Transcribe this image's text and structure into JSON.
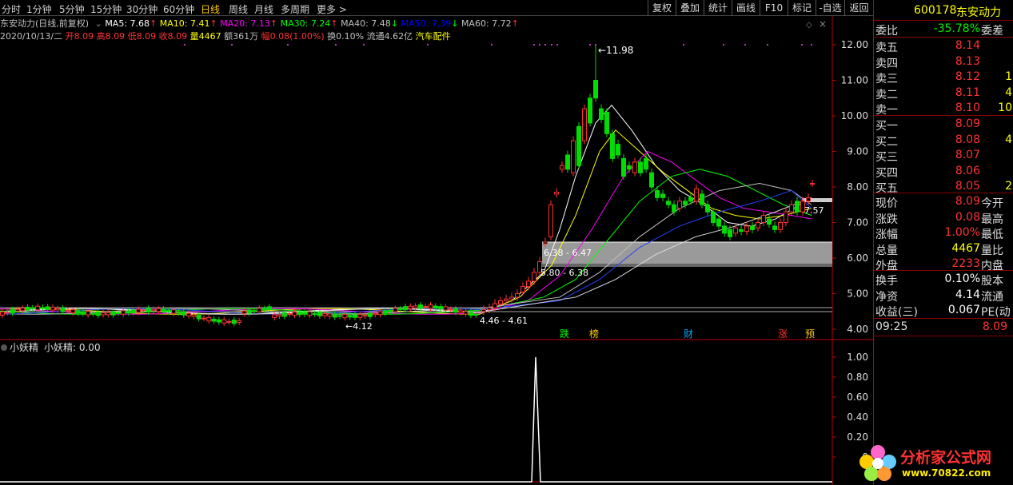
{
  "toolbar": {
    "periods": [
      "分时",
      "1分钟",
      "5分钟",
      "15分钟",
      "30分钟",
      "60分钟",
      "日线",
      "周线",
      "月线",
      "多周期",
      "更多 >"
    ],
    "active_period": "日线",
    "buttons": [
      "复权",
      "叠加",
      "统计",
      "画线",
      "F10",
      "标记",
      "-自选",
      "返回"
    ]
  },
  "ma": [
    {
      "label": "东安动力(日线,前复权)",
      "color": "#c0c0c0"
    },
    {
      "label": "MA5: 7.68",
      "color": "#ffffff",
      "arrow": "↑",
      "arrow_color": "#ff3333"
    },
    {
      "label": "MA10: 7.41",
      "color": "#ffff00",
      "arrow": "↑",
      "arrow_color": "#ff3333"
    },
    {
      "label": "MA20: 7.13",
      "color": "#ff00ff",
      "arrow": "↑",
      "arrow_color": "#ff3333"
    },
    {
      "label": "MA30: 7.24",
      "color": "#00ff00",
      "arrow": "↑",
      "arrow_color": "#ff3333"
    },
    {
      "label": "MA40: 7.48",
      "color": "#c0c0c0",
      "arrow": "↓",
      "arrow_color": "#00ff00"
    },
    {
      "label": "MA50: 7.39",
      "color": "#0000ff",
      "arrow": "↓",
      "arrow_color": "#00ff00"
    },
    {
      "label": "MA60: 7.72",
      "color": "#c0c0c0",
      "arrow": "↑",
      "arrow_color": "#ff3333"
    }
  ],
  "info": {
    "date": "2020/10/13/二",
    "open": "开8.09",
    "high": "高8.09",
    "low": "低8.09",
    "close": "收8.09",
    "vol": "量4467",
    "amount": "额361万",
    "change": "幅0.08(1.00%)",
    "turnover": "换0.10%",
    "float": "流通4.62亿",
    "sector": "汽车配件"
  },
  "main_axis": [
    "12.00",
    "11.00",
    "10.00",
    "9.00",
    "8.00",
    "7.00",
    "6.00",
    "5.00",
    "4.00"
  ],
  "annotations": {
    "high": "11.98",
    "low": "4.12",
    "zone1": "6.38 - 6.47",
    "zone2": "5.80 - 6.38",
    "zone3": "4.46 - 4.61",
    "price": "7.57"
  },
  "markers": [
    {
      "text": "跌",
      "color": "#00ff00"
    },
    {
      "text": "榜",
      "color": "#ffcc00"
    },
    {
      "text": "财",
      "color": "#00aaff"
    },
    {
      "text": "涨",
      "color": "#ff3333"
    },
    {
      "text": "预",
      "color": "#ffcc00"
    }
  ],
  "indicator": {
    "title": "小妖精",
    "label": "小妖精: 0.00",
    "axis": [
      "1.00",
      "0.80",
      "0.60",
      "0.40",
      "0.20",
      "0"
    ]
  },
  "quote": {
    "code": "600178",
    "name": "东安动力",
    "weibi_label": "委比",
    "weibi": "-35.78%",
    "weicha_label": "委差",
    "asks": [
      {
        "label": "卖五",
        "price": "8.14"
      },
      {
        "label": "卖四",
        "price": "8.13"
      },
      {
        "label": "卖三",
        "price": "8.12",
        "vol": "1"
      },
      {
        "label": "卖二",
        "price": "8.11",
        "vol": "4"
      },
      {
        "label": "卖一",
        "price": "8.10",
        "vol": "10"
      }
    ],
    "bids": [
      {
        "label": "买一",
        "price": "8.09"
      },
      {
        "label": "买二",
        "price": "8.08",
        "vol": "4"
      },
      {
        "label": "买三",
        "price": "8.07"
      },
      {
        "label": "买四",
        "price": "8.06"
      },
      {
        "label": "买五",
        "price": "8.05",
        "vol": "2"
      }
    ],
    "stats": [
      {
        "label": "现价",
        "value": "8.09",
        "l2": "今开",
        "color": "#ff3333"
      },
      {
        "label": "涨跌",
        "value": "0.08",
        "l2": "最高",
        "color": "#ff3333"
      },
      {
        "label": "涨幅",
        "value": "1.00%",
        "l2": "最低",
        "color": "#ff3333"
      },
      {
        "label": "总量",
        "value": "4467",
        "l2": "量比",
        "color": "#ffff00"
      },
      {
        "label": "外盘",
        "value": "2233",
        "l2": "内盘",
        "color": "#ff3333"
      }
    ],
    "stats2": [
      {
        "label": "换手",
        "value": "0.10%",
        "l2": "股本",
        "color": "#ffffff"
      },
      {
        "label": "净资",
        "value": "4.14",
        "l2": "流通",
        "color": "#ffffff"
      },
      {
        "label": "收益(三)",
        "value": "0.067",
        "l2": "PE(动",
        "color": "#ffffff"
      }
    ],
    "tick_time": "09:25",
    "tick_price": "8.09"
  },
  "watermark": {
    "title": "分析家公式网",
    "url": "www.70822.com"
  }
}
